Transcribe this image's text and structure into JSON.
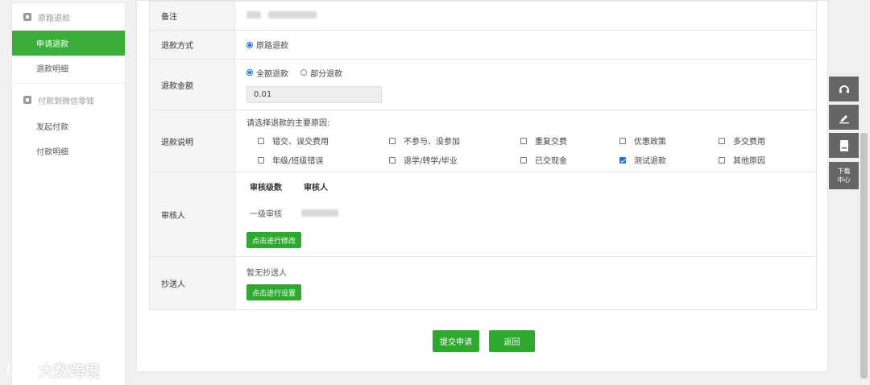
{
  "sidebar": {
    "group1": {
      "label": "原路退款",
      "icon": "refund-icon"
    },
    "group1_items": [
      {
        "label": "申请退款",
        "active": true
      },
      {
        "label": "退款明细",
        "active": false
      }
    ],
    "group2": {
      "label": "付款到微信零钱",
      "icon": "wallet-icon"
    },
    "group2_items": [
      {
        "label": "发起付款",
        "active": false
      },
      {
        "label": "付款明细",
        "active": false
      }
    ]
  },
  "form": {
    "remark": {
      "label": "备注"
    },
    "method": {
      "label": "退款方式",
      "option": "原路退款"
    },
    "amount": {
      "label": "退款金额",
      "option_full": "全额退款",
      "option_partial": "部分退款",
      "value": "0.01"
    },
    "reason": {
      "label": "退款说明",
      "prompt": "请选择退款的主要原因:",
      "options": [
        {
          "label": "错交、误交费用",
          "checked": false
        },
        {
          "label": "不参与、没参加",
          "checked": false
        },
        {
          "label": "重复交费",
          "checked": false
        },
        {
          "label": "优惠政策",
          "checked": false
        },
        {
          "label": "多交费用",
          "checked": false
        },
        {
          "label": "年级/班级错误",
          "checked": false
        },
        {
          "label": "退学/转学/毕业",
          "checked": false
        },
        {
          "label": "已交现金",
          "checked": false
        },
        {
          "label": "测试退款",
          "checked": true
        },
        {
          "label": "其他原因",
          "checked": false
        }
      ]
    },
    "auditor": {
      "label": "审核人",
      "col_level": "审核级数",
      "col_person": "审核人",
      "row_level": "一级审核",
      "modify_button": "点击进行修改"
    },
    "cc": {
      "label": "抄送人",
      "empty_text": "暂无抄送人",
      "set_button": "点击进行设置"
    }
  },
  "actions": {
    "submit": "提交申请",
    "back": "返回"
  },
  "toolbar": {
    "items": [
      "headset-icon",
      "edit-icon",
      "book-icon"
    ],
    "download_center_line1": "下载",
    "download_center_line2": "中心"
  },
  "watermark": {
    "text": "大数跨境"
  },
  "colors": {
    "accent": "#2ea82e",
    "radio": "#1e6fd9",
    "toolbar": "#666666"
  }
}
